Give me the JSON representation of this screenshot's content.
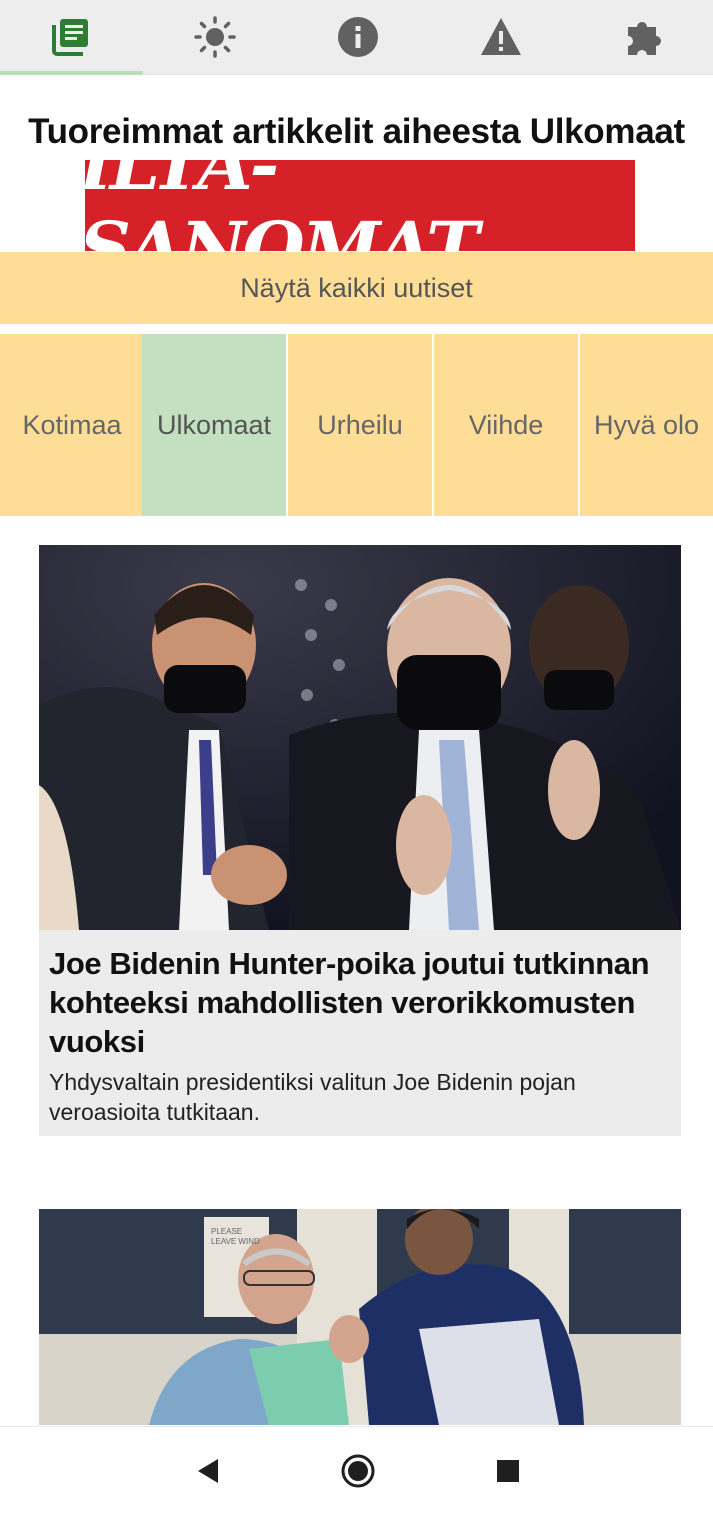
{
  "toolbar": {
    "tabs": [
      {
        "icon": "newspaper-icon",
        "active": true
      },
      {
        "icon": "brightness-icon",
        "active": false
      },
      {
        "icon": "info-icon",
        "active": false
      },
      {
        "icon": "warning-icon",
        "active": false
      },
      {
        "icon": "puzzle-icon",
        "active": false
      }
    ],
    "active_color": "#2e7d32",
    "icon_color": "#616161"
  },
  "page": {
    "heading": "Tuoreimmat artikkelit aiheesta Ulkomaat",
    "logo_text": "ILTA-SANOMAT",
    "show_all_label": "Näytä kaikki uutiset"
  },
  "categories": [
    {
      "label": "Kotimaa",
      "active": false
    },
    {
      "label": "Ulkomaat",
      "active": true
    },
    {
      "label": "Urheilu",
      "active": false
    },
    {
      "label": "Viihde",
      "active": false
    },
    {
      "label": "Hyvä olo",
      "active": false
    }
  ],
  "colors": {
    "category_bg": "#fedd97",
    "category_active_bg": "#c3e0c0",
    "logo_red": "#d62128"
  },
  "articles": [
    {
      "title": "Joe Bidenin Hunter-poika joutui tutkinnan kohteeksi mahdollisten verorikkomusten vuoksi",
      "description": "Yhdysvaltain presidentiksi valitun Joe Bidenin pojan veroasioita tutkitaan."
    },
    {
      "title": "",
      "description": "",
      "sign_text": "PLEASE LEAVE WIND"
    }
  ],
  "navigation": {
    "buttons": [
      "back-icon",
      "home-icon",
      "recents-icon"
    ]
  }
}
